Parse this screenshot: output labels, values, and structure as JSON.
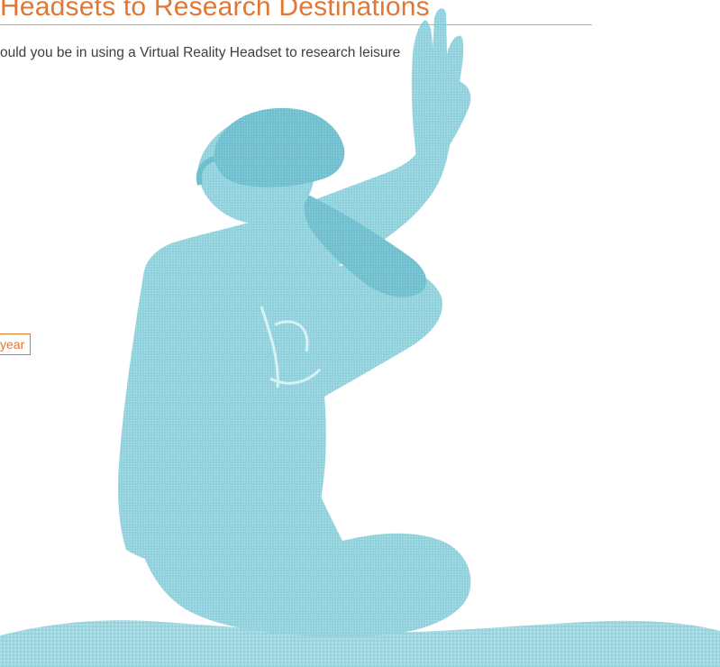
{
  "heading": {
    "title": "Headsets to Research Destinations"
  },
  "survey": {
    "question": "ould you be in using a Virtual Reality Headset to research leisure"
  },
  "option": {
    "label": "year"
  },
  "colors": {
    "accent": "#e27734",
    "rule": "#e9a36f",
    "photo_tint": "#8fd1dc",
    "body_text": "#3f3f3f"
  }
}
